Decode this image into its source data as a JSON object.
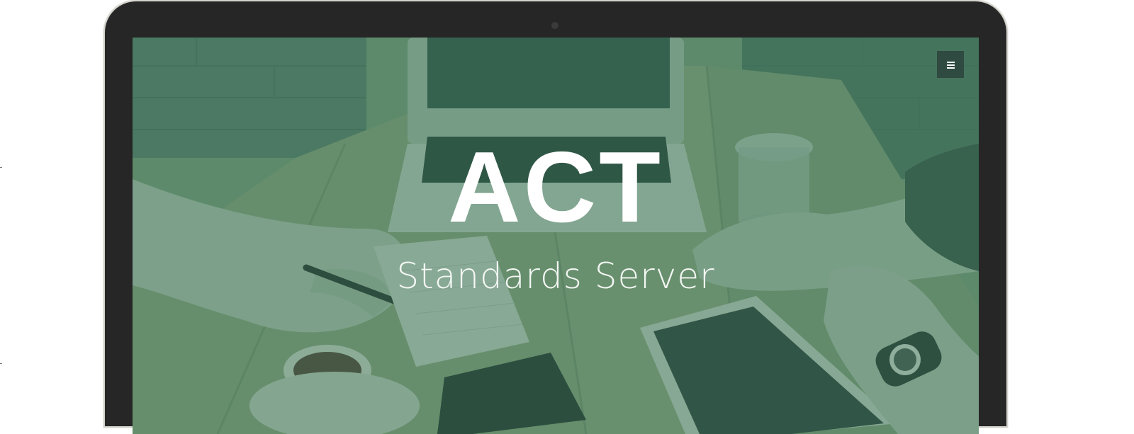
{
  "hero": {
    "title": "ACT",
    "subtitle": "Standards Server"
  },
  "icons": {
    "menu": "hamburger-menu-icon",
    "camera": "camera-icon"
  },
  "colors": {
    "bezel": "#262626",
    "overlay": "#2f6850",
    "menu_button_bg": "#2f4a40",
    "text": "#ffffff"
  }
}
